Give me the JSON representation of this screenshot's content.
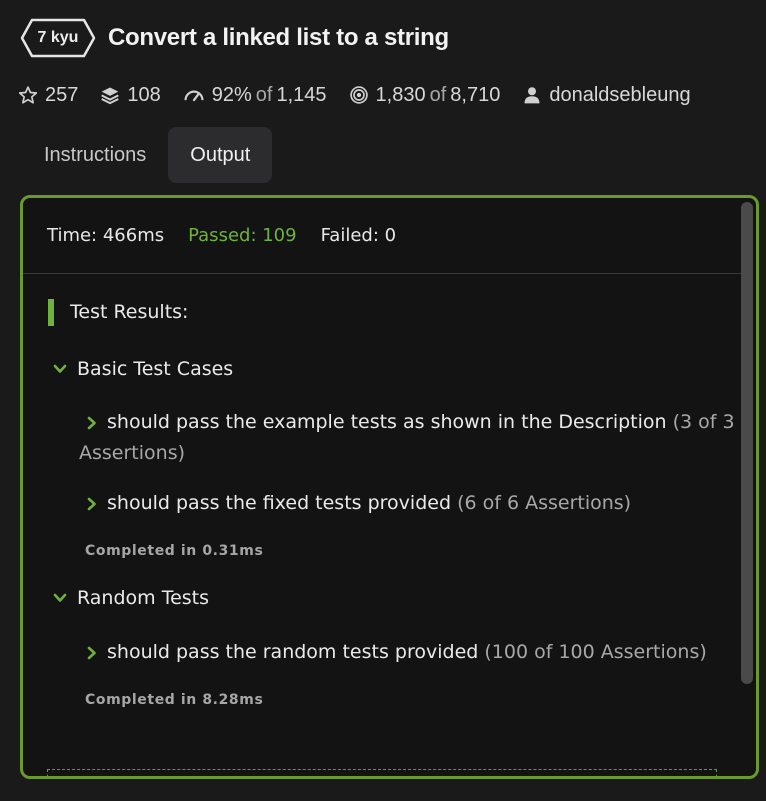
{
  "kata": {
    "rank_badge": "7 kyu",
    "title": "Convert a linked list to a string"
  },
  "stats": {
    "stars": "257",
    "collections": "108",
    "satisfaction": "92%",
    "satisfaction_of": "of",
    "satisfaction_votes": "1,145",
    "completed": "1,830",
    "completed_of": "of",
    "attempts": "8,710",
    "author": "donaldsebleung"
  },
  "tabs": [
    {
      "label": "Instructions",
      "active": false
    },
    {
      "label": "Output",
      "active": true
    }
  ],
  "output": {
    "time": "Time: 466ms",
    "passed": "Passed: 109",
    "failed": "Failed: 0",
    "results_heading": "Test Results:",
    "groups": [
      {
        "name": "Basic Test Cases",
        "tests": [
          {
            "text": "should pass the example tests as shown in the Description",
            "assertions": "(3 of 3 Assertions)"
          },
          {
            "text": "should pass the fixed tests provided",
            "assertions": "(6 of 6 Assertions)"
          }
        ],
        "completed": "Completed in 0.31ms"
      },
      {
        "name": "Random Tests",
        "tests": [
          {
            "text": "should pass the random tests provided",
            "assertions": "(100 of 100 Assertions)"
          }
        ],
        "completed": "Completed in 8.28ms"
      }
    ]
  },
  "colors": {
    "accent_green": "#6fb13f",
    "panel_border": "#6a9a2c",
    "background": "#1a1a1b"
  },
  "icons": {
    "stars": "star-outline-icon",
    "collections": "layers-icon",
    "satisfaction": "gauge-icon",
    "completed": "target-icon",
    "author": "user-icon",
    "group_toggle": "chevron-down-icon",
    "test_toggle": "chevron-right-icon"
  }
}
